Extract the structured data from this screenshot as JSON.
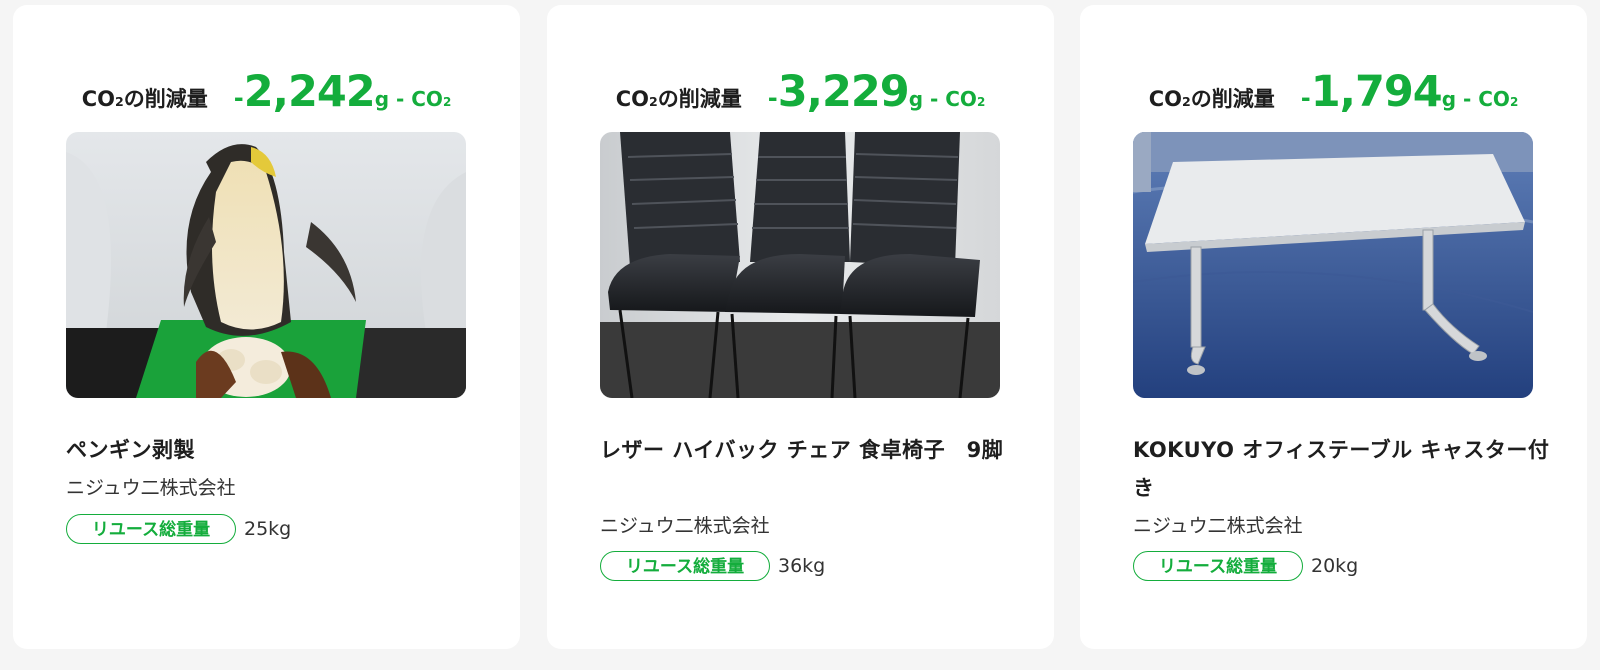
{
  "products": [
    {
      "co2_label": "CO",
      "co2_sub": "2",
      "co2_label_suffix": "の削減量",
      "co2_minus": "-",
      "co2_amount": "2,242",
      "co2_unit": "g - CO",
      "co2_unit_sub": "2",
      "title": "ペンギン剥製",
      "company": "ニジュウ二株式会社",
      "badge": "リユース総重量",
      "weight": "25kg",
      "photo_icon": "penguin-taxidermy-photo"
    },
    {
      "co2_label": "CO",
      "co2_sub": "2",
      "co2_label_suffix": "の削減量",
      "co2_minus": "-",
      "co2_amount": "3,229",
      "co2_unit": "g - CO",
      "co2_unit_sub": "2",
      "title": "レザー ハイバック チェア 食卓椅子　9脚",
      "company": "ニジュウ二株式会社",
      "badge": "リユース総重量",
      "weight": "36kg",
      "photo_icon": "leather-chairs-photo"
    },
    {
      "co2_label": "CO",
      "co2_sub": "2",
      "co2_label_suffix": "の削減量",
      "co2_minus": "-",
      "co2_amount": "1,794",
      "co2_unit": "g - CO",
      "co2_unit_sub": "2",
      "title": "KOKUYO オフィステーブル キャスター付き",
      "company": "ニジュウ二株式会社",
      "badge": "リユース総重量",
      "weight": "20kg",
      "photo_icon": "office-table-photo"
    }
  ],
  "colors": {
    "accent_green": "#14ad3c",
    "card_bg": "#ffffff",
    "page_bg": "#f5f5f5"
  }
}
